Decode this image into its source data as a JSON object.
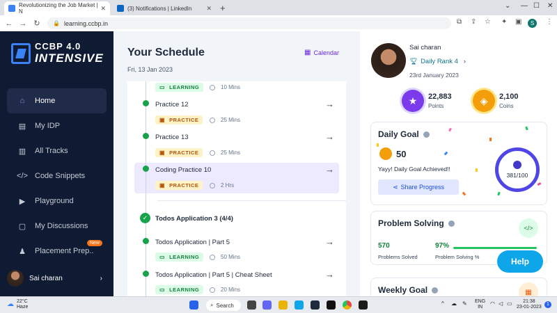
{
  "browser": {
    "tabs": [
      {
        "title": "Revolutionizing the Job Market | N"
      },
      {
        "title": "(3) Notifications | LinkedIn"
      }
    ],
    "url": "learning.ccbp.in",
    "profile_initial": "S"
  },
  "sidebar": {
    "logo_line1": "CCBP 4.0",
    "logo_line2": "INTENSIVE",
    "items": [
      {
        "label": "Home",
        "icon": "home-icon"
      },
      {
        "label": "My IDP",
        "icon": "idp-icon"
      },
      {
        "label": "All Tracks",
        "icon": "book-icon"
      },
      {
        "label": "Code Snippets",
        "icon": "code-icon"
      },
      {
        "label": "Playground",
        "icon": "play-icon"
      },
      {
        "label": "My Discussions",
        "icon": "chat-icon"
      },
      {
        "label": "Placement Prep..",
        "icon": "placement-icon",
        "badge": "New"
      }
    ],
    "user": "Sai charan"
  },
  "schedule": {
    "title": "Your Schedule",
    "date": "Fri, 13 Jan 2023",
    "calendar_label": "Calendar",
    "items": [
      {
        "tag": "LEARNING",
        "duration": "10 Mins"
      },
      {
        "title": "Practice 12",
        "tag": "PRACTICE",
        "duration": "25 Mins"
      },
      {
        "title": "Practice 13",
        "tag": "PRACTICE",
        "duration": "25 Mins"
      },
      {
        "title": "Coding Practice 10",
        "tag": "PRACTICE",
        "duration": "2 Hrs"
      },
      {
        "title": "Todos Application | Part 5",
        "tag": "LEARNING",
        "duration": "50 Mins"
      },
      {
        "title": "Todos Application | Part 5 | Cheat Sheet",
        "tag": "LEARNING",
        "duration": "20 Mins"
      }
    ],
    "section_title": "Todos Application 3 (4/4)"
  },
  "profile": {
    "name": "Sai charan",
    "rank": "Daily Rank 4",
    "date": "23rd January 2023",
    "points_value": "22,883",
    "points_label": "Points",
    "coins_value": "2,100",
    "coins_label": "Coins"
  },
  "daily_goal": {
    "title": "Daily Goal",
    "value": "50",
    "message": "Yayy! Daily Goal Achieved!!",
    "share_label": "Share Progress",
    "progress": "381/100"
  },
  "problem_solving": {
    "title": "Problem Solving",
    "solved_value": "570",
    "solved_label": "Problems Solved",
    "percent_value": "97%",
    "percent_label": "Problem Solving %"
  },
  "weekly_goal": {
    "title": "Weekly Goal"
  },
  "help_label": "Help",
  "taskbar": {
    "temp": "22°C",
    "weather": "Haze",
    "search": "Search",
    "lang1": "ENG",
    "lang2": "IN",
    "time": "21:38",
    "date": "23-01-2023"
  }
}
